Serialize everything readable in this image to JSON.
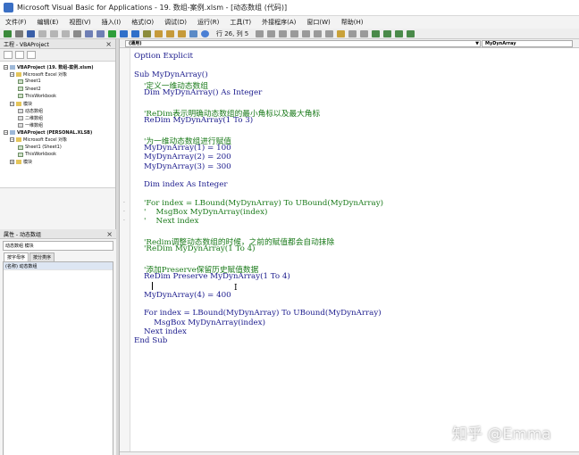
{
  "window": {
    "title": "Microsoft Visual Basic for Applications - 19. 数组-案例.xlsm - [动态数组 (代码)]"
  },
  "menu": [
    "文件(F)",
    "编辑(E)",
    "视图(V)",
    "插入(I)",
    "格式(O)",
    "调试(D)",
    "运行(R)",
    "工具(T)",
    "外接程序(A)",
    "窗口(W)",
    "帮助(H)"
  ],
  "toolbar": {
    "position": "行 26, 列 5"
  },
  "project_panel": {
    "title": "工程 - VBAProject",
    "tree": [
      {
        "label": "VBAProject (19. 数组-案例.xlsm)",
        "kind": "proj",
        "exp": "−",
        "bold": true
      },
      {
        "label": "Microsoft Excel 对象",
        "kind": "folder",
        "exp": "−"
      },
      {
        "label": "Sheet1",
        "kind": "sheet"
      },
      {
        "label": "Sheet2",
        "kind": "sheet"
      },
      {
        "label": "ThisWorkbook",
        "kind": "sheet"
      },
      {
        "label": "模块",
        "kind": "folder",
        "exp": "−"
      },
      {
        "label": "动态数组",
        "kind": "module"
      },
      {
        "label": "二维数组",
        "kind": "module"
      },
      {
        "label": "一维数组",
        "kind": "module"
      },
      {
        "label": "VBAProject (PERSONAL.XLSB)",
        "kind": "proj",
        "exp": "−",
        "bold": true
      },
      {
        "label": "Microsoft Excel 对象",
        "kind": "folder",
        "exp": "−"
      },
      {
        "label": "Sheet1 (Sheet1)",
        "kind": "sheet"
      },
      {
        "label": "ThisWorkbook",
        "kind": "sheet"
      },
      {
        "label": "模块",
        "kind": "folder",
        "exp": "+"
      }
    ]
  },
  "props_panel": {
    "title": "属性 - 动态数组",
    "selected": "动态数组 模块",
    "tabs": [
      "按字母序",
      "按分类序"
    ],
    "rows": [
      "(名称) 动态数组"
    ]
  },
  "code_window": {
    "object_combo": "(通用)",
    "proc_combo": "MyDynArray",
    "lines": [
      {
        "code": "Option Explicit"
      },
      {
        "code": ""
      },
      {
        "code": "Sub MyDynArray()"
      },
      {
        "code": "    ",
        "comment": "'定义一维动态数组"
      },
      {
        "code": "    Dim MyDynArray() As Integer"
      },
      {
        "code": ""
      },
      {
        "code": "    ",
        "comment": "'ReDim表示明确动态数组的最小角标以及最大角标"
      },
      {
        "code": "    ReDim MyDynArray(1 To 3)"
      },
      {
        "code": ""
      },
      {
        "code": "    ",
        "comment": "'为一维动态数组进行赋值"
      },
      {
        "code": "    MyDynArray(1) = 100"
      },
      {
        "code": "    MyDynArray(2) = 200"
      },
      {
        "code": "    MyDynArray(3) = 300"
      },
      {
        "code": ""
      },
      {
        "code": "    Dim index As Integer"
      },
      {
        "code": ""
      },
      {
        "code": "    ",
        "comment": "'For index = LBound(MyDynArray) To UBound(MyDynArray)"
      },
      {
        "code": "    ",
        "comment": "'    MsgBox MyDynArray(index)"
      },
      {
        "code": "    ",
        "comment": "'    Next index"
      },
      {
        "code": ""
      },
      {
        "code": "    ",
        "comment": "'Redim调整动态数组的时候，之前的赋值都会自动抹除"
      },
      {
        "code": "    ",
        "comment": "'ReDim MyDynArray(1 To 4)"
      },
      {
        "code": ""
      },
      {
        "code": "    ",
        "comment": "'添加Preserve保留历史赋值数据"
      },
      {
        "code": "    ReDim Preserve MyDynArray(1 To 4)"
      },
      {
        "code": ""
      },
      {
        "code": "    MyDynArray(4) = 400"
      },
      {
        "code": ""
      },
      {
        "code": "    For index = LBound(MyDynArray) To UBound(MyDynArray)"
      },
      {
        "code": "        MsgBox MyDynArray(index)"
      },
      {
        "code": "    Next index"
      },
      {
        "code": "End Sub"
      }
    ]
  },
  "watermark": "知乎 @Emma"
}
